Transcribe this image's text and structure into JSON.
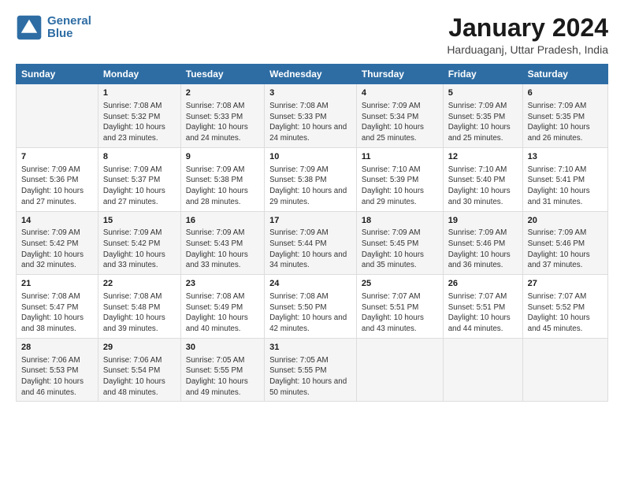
{
  "header": {
    "logo_line1": "General",
    "logo_line2": "Blue",
    "main_title": "January 2024",
    "subtitle": "Harduaganj, Uttar Pradesh, India"
  },
  "days_of_week": [
    "Sunday",
    "Monday",
    "Tuesday",
    "Wednesday",
    "Thursday",
    "Friday",
    "Saturday"
  ],
  "weeks": [
    [
      {
        "day": "",
        "sunrise": "",
        "sunset": "",
        "daylight": ""
      },
      {
        "day": "1",
        "sunrise": "Sunrise: 7:08 AM",
        "sunset": "Sunset: 5:32 PM",
        "daylight": "Daylight: 10 hours and 23 minutes."
      },
      {
        "day": "2",
        "sunrise": "Sunrise: 7:08 AM",
        "sunset": "Sunset: 5:33 PM",
        "daylight": "Daylight: 10 hours and 24 minutes."
      },
      {
        "day": "3",
        "sunrise": "Sunrise: 7:08 AM",
        "sunset": "Sunset: 5:33 PM",
        "daylight": "Daylight: 10 hours and 24 minutes."
      },
      {
        "day": "4",
        "sunrise": "Sunrise: 7:09 AM",
        "sunset": "Sunset: 5:34 PM",
        "daylight": "Daylight: 10 hours and 25 minutes."
      },
      {
        "day": "5",
        "sunrise": "Sunrise: 7:09 AM",
        "sunset": "Sunset: 5:35 PM",
        "daylight": "Daylight: 10 hours and 25 minutes."
      },
      {
        "day": "6",
        "sunrise": "Sunrise: 7:09 AM",
        "sunset": "Sunset: 5:35 PM",
        "daylight": "Daylight: 10 hours and 26 minutes."
      }
    ],
    [
      {
        "day": "7",
        "sunrise": "Sunrise: 7:09 AM",
        "sunset": "Sunset: 5:36 PM",
        "daylight": "Daylight: 10 hours and 27 minutes."
      },
      {
        "day": "8",
        "sunrise": "Sunrise: 7:09 AM",
        "sunset": "Sunset: 5:37 PM",
        "daylight": "Daylight: 10 hours and 27 minutes."
      },
      {
        "day": "9",
        "sunrise": "Sunrise: 7:09 AM",
        "sunset": "Sunset: 5:38 PM",
        "daylight": "Daylight: 10 hours and 28 minutes."
      },
      {
        "day": "10",
        "sunrise": "Sunrise: 7:09 AM",
        "sunset": "Sunset: 5:38 PM",
        "daylight": "Daylight: 10 hours and 29 minutes."
      },
      {
        "day": "11",
        "sunrise": "Sunrise: 7:10 AM",
        "sunset": "Sunset: 5:39 PM",
        "daylight": "Daylight: 10 hours and 29 minutes."
      },
      {
        "day": "12",
        "sunrise": "Sunrise: 7:10 AM",
        "sunset": "Sunset: 5:40 PM",
        "daylight": "Daylight: 10 hours and 30 minutes."
      },
      {
        "day": "13",
        "sunrise": "Sunrise: 7:10 AM",
        "sunset": "Sunset: 5:41 PM",
        "daylight": "Daylight: 10 hours and 31 minutes."
      }
    ],
    [
      {
        "day": "14",
        "sunrise": "Sunrise: 7:09 AM",
        "sunset": "Sunset: 5:42 PM",
        "daylight": "Daylight: 10 hours and 32 minutes."
      },
      {
        "day": "15",
        "sunrise": "Sunrise: 7:09 AM",
        "sunset": "Sunset: 5:42 PM",
        "daylight": "Daylight: 10 hours and 33 minutes."
      },
      {
        "day": "16",
        "sunrise": "Sunrise: 7:09 AM",
        "sunset": "Sunset: 5:43 PM",
        "daylight": "Daylight: 10 hours and 33 minutes."
      },
      {
        "day": "17",
        "sunrise": "Sunrise: 7:09 AM",
        "sunset": "Sunset: 5:44 PM",
        "daylight": "Daylight: 10 hours and 34 minutes."
      },
      {
        "day": "18",
        "sunrise": "Sunrise: 7:09 AM",
        "sunset": "Sunset: 5:45 PM",
        "daylight": "Daylight: 10 hours and 35 minutes."
      },
      {
        "day": "19",
        "sunrise": "Sunrise: 7:09 AM",
        "sunset": "Sunset: 5:46 PM",
        "daylight": "Daylight: 10 hours and 36 minutes."
      },
      {
        "day": "20",
        "sunrise": "Sunrise: 7:09 AM",
        "sunset": "Sunset: 5:46 PM",
        "daylight": "Daylight: 10 hours and 37 minutes."
      }
    ],
    [
      {
        "day": "21",
        "sunrise": "Sunrise: 7:08 AM",
        "sunset": "Sunset: 5:47 PM",
        "daylight": "Daylight: 10 hours and 38 minutes."
      },
      {
        "day": "22",
        "sunrise": "Sunrise: 7:08 AM",
        "sunset": "Sunset: 5:48 PM",
        "daylight": "Daylight: 10 hours and 39 minutes."
      },
      {
        "day": "23",
        "sunrise": "Sunrise: 7:08 AM",
        "sunset": "Sunset: 5:49 PM",
        "daylight": "Daylight: 10 hours and 40 minutes."
      },
      {
        "day": "24",
        "sunrise": "Sunrise: 7:08 AM",
        "sunset": "Sunset: 5:50 PM",
        "daylight": "Daylight: 10 hours and 42 minutes."
      },
      {
        "day": "25",
        "sunrise": "Sunrise: 7:07 AM",
        "sunset": "Sunset: 5:51 PM",
        "daylight": "Daylight: 10 hours and 43 minutes."
      },
      {
        "day": "26",
        "sunrise": "Sunrise: 7:07 AM",
        "sunset": "Sunset: 5:51 PM",
        "daylight": "Daylight: 10 hours and 44 minutes."
      },
      {
        "day": "27",
        "sunrise": "Sunrise: 7:07 AM",
        "sunset": "Sunset: 5:52 PM",
        "daylight": "Daylight: 10 hours and 45 minutes."
      }
    ],
    [
      {
        "day": "28",
        "sunrise": "Sunrise: 7:06 AM",
        "sunset": "Sunset: 5:53 PM",
        "daylight": "Daylight: 10 hours and 46 minutes."
      },
      {
        "day": "29",
        "sunrise": "Sunrise: 7:06 AM",
        "sunset": "Sunset: 5:54 PM",
        "daylight": "Daylight: 10 hours and 48 minutes."
      },
      {
        "day": "30",
        "sunrise": "Sunrise: 7:05 AM",
        "sunset": "Sunset: 5:55 PM",
        "daylight": "Daylight: 10 hours and 49 minutes."
      },
      {
        "day": "31",
        "sunrise": "Sunrise: 7:05 AM",
        "sunset": "Sunset: 5:55 PM",
        "daylight": "Daylight: 10 hours and 50 minutes."
      },
      {
        "day": "",
        "sunrise": "",
        "sunset": "",
        "daylight": ""
      },
      {
        "day": "",
        "sunrise": "",
        "sunset": "",
        "daylight": ""
      },
      {
        "day": "",
        "sunrise": "",
        "sunset": "",
        "daylight": ""
      }
    ]
  ]
}
